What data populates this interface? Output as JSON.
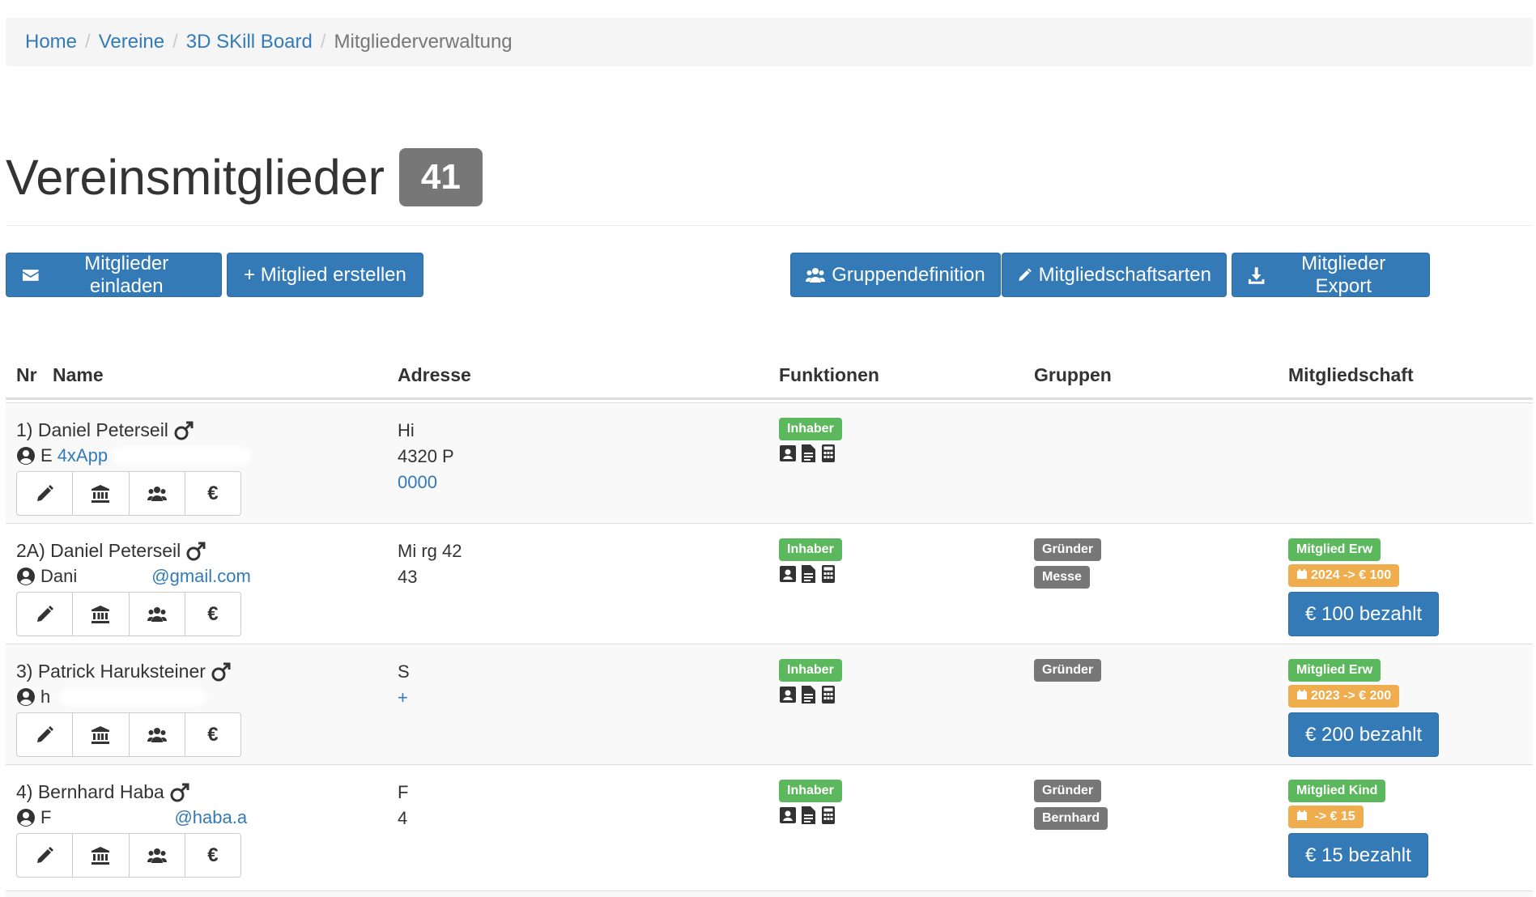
{
  "breadcrumb": {
    "items": [
      "Home",
      "Vereine",
      "3D SKill Board"
    ],
    "active": "Mitgliederverwaltung"
  },
  "page": {
    "title": "Vereinsmitglieder",
    "member_count": "41"
  },
  "toolbar": {
    "invite": "Mitglieder einladen",
    "create": "+ Mitglied erstellen",
    "groups": "Gruppendefinition",
    "membership_types": "Mitgliedschaftsarten",
    "export": "Mitglieder Export"
  },
  "table": {
    "headers": {
      "nr": "Nr",
      "name": "Name",
      "address": "Adresse",
      "functions": "Funktionen",
      "groups": "Gruppen",
      "membership": "Mitgliedschaft"
    },
    "rows": [
      {
        "name": "1) Daniel Peterseil",
        "contact_name": "E",
        "contact_email": "4xApp",
        "address": [
          "Hi",
          "4320 P",
          "0000"
        ],
        "functions": [
          "Inhaber"
        ],
        "groups": [],
        "membership": null
      },
      {
        "name": "2A) Daniel Peterseil",
        "contact_name": "Dani",
        "contact_email": "@gmail.com",
        "address": [
          "Mi     rg 42",
          "43",
          ""
        ],
        "functions": [
          "Inhaber"
        ],
        "groups": [
          "Gründer",
          "Messe"
        ],
        "membership": {
          "type": "Mitglied Erw",
          "period": "2024 -> € 100",
          "paid": "€ 100 bezahlt"
        }
      },
      {
        "name": "3) Patrick Haruksteiner",
        "contact_name": "h",
        "contact_email": "",
        "address": [
          "S",
          "",
          "+"
        ],
        "functions": [
          "Inhaber"
        ],
        "groups": [
          "Gründer"
        ],
        "membership": {
          "type": "Mitglied Erw",
          "period": "2023 -> € 200",
          "paid": "€ 200 bezahlt"
        }
      },
      {
        "name": "4) Bernhard Haba",
        "contact_name": "F",
        "contact_email": "@haba.a",
        "address": [
          "F",
          "4",
          ""
        ],
        "functions": [
          "Inhaber"
        ],
        "groups": [
          "Gründer",
          "Bernhard"
        ],
        "membership": {
          "type": "Mitglied Kind",
          "period": " -> € 15",
          "paid": "€ 15 bezahlt"
        }
      }
    ]
  },
  "icons": {
    "invite": "envelope-icon",
    "groups": "users-icon",
    "membership_types": "pencil-icon",
    "export": "download-icon",
    "row_actions": [
      "pencil-icon",
      "bank-icon",
      "users-icon",
      "euro-icon"
    ],
    "function_icons": [
      "contact-card-icon",
      "document-icon",
      "calculator-icon"
    ]
  },
  "colors": {
    "primary": "#337ab7",
    "success": "#5cb85c",
    "warning": "#f0ad4e",
    "default_label": "#777777"
  }
}
